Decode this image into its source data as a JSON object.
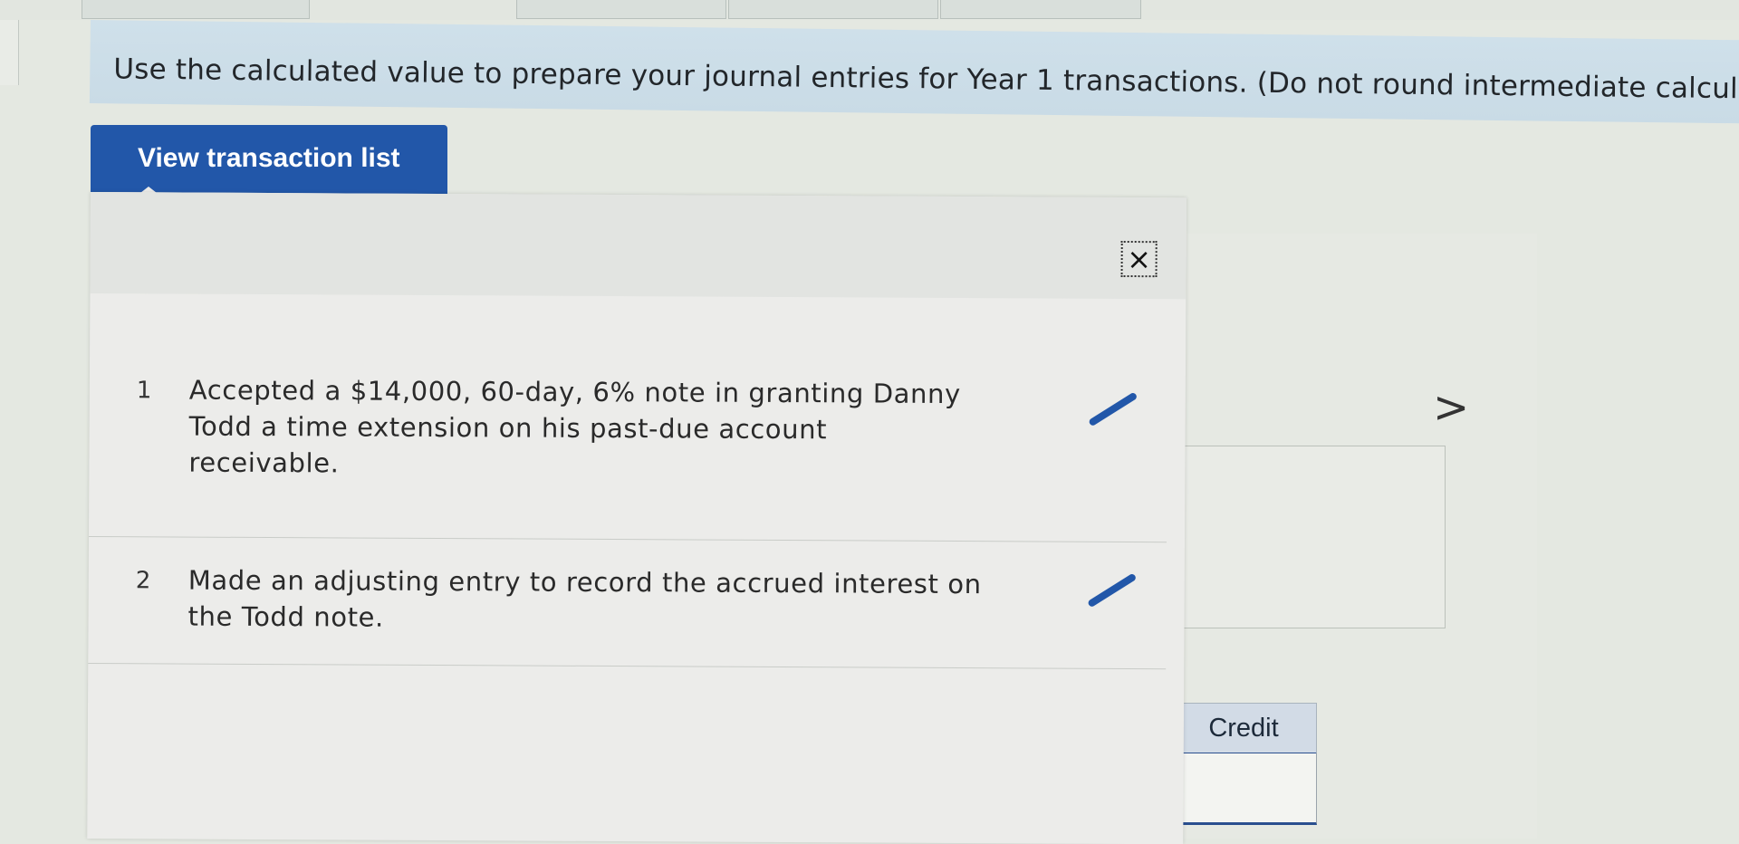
{
  "instruction": {
    "text": "Use the calculated value to prepare your journal entries for Year 1 transactions. (Do not round intermediate calcul"
  },
  "view_button": {
    "label": "View transaction list"
  },
  "popup": {
    "close_icon": "×",
    "transactions": [
      {
        "number": "1",
        "description": "Accepted a $14,000, 60-day, 6% note in granting Danny Todd a time extension on his past-due account receivable."
      },
      {
        "number": "2",
        "description": "Made an adjusting entry to record the accrued interest on the Todd note."
      }
    ]
  },
  "background": {
    "next_arrow": ">",
    "credit_header": "Credit"
  },
  "colors": {
    "button_blue": "#2257a9",
    "banner": "#cfe0ea",
    "edit_icon": "#2257a9"
  }
}
